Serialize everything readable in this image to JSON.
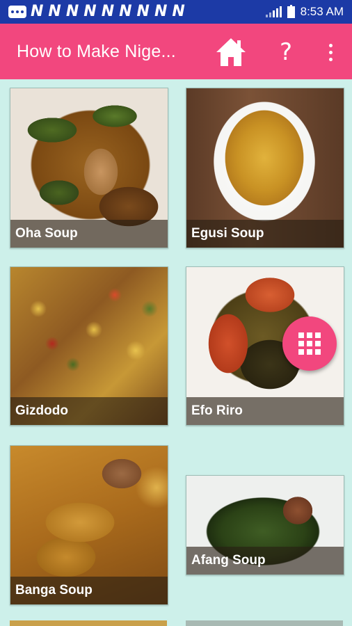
{
  "status_bar": {
    "notification_letters": [
      "N",
      "N",
      "N",
      "N",
      "N",
      "N",
      "N",
      "N",
      "N"
    ],
    "time": "8:53 AM",
    "icons": [
      "message-icon",
      "signal-icon",
      "battery-icon"
    ]
  },
  "app_bar": {
    "title": "How to Make Nige...",
    "home_icon": "home-icon",
    "help_label": "?",
    "more_icon": "more-vert-icon",
    "color": "#f2477e"
  },
  "recipes": [
    {
      "name": "Oha Soup"
    },
    {
      "name": "Egusi Soup"
    },
    {
      "name": "Gizdodo"
    },
    {
      "name": "Efo Riro"
    },
    {
      "name": "Banga Soup"
    },
    {
      "name": "Afang Soup"
    }
  ],
  "fab": {
    "icon": "apps-grid-icon",
    "color": "#f2477e"
  },
  "colors": {
    "background": "#cdf0ea",
    "status_bar": "#1c3aa6",
    "accent": "#f2477e"
  }
}
